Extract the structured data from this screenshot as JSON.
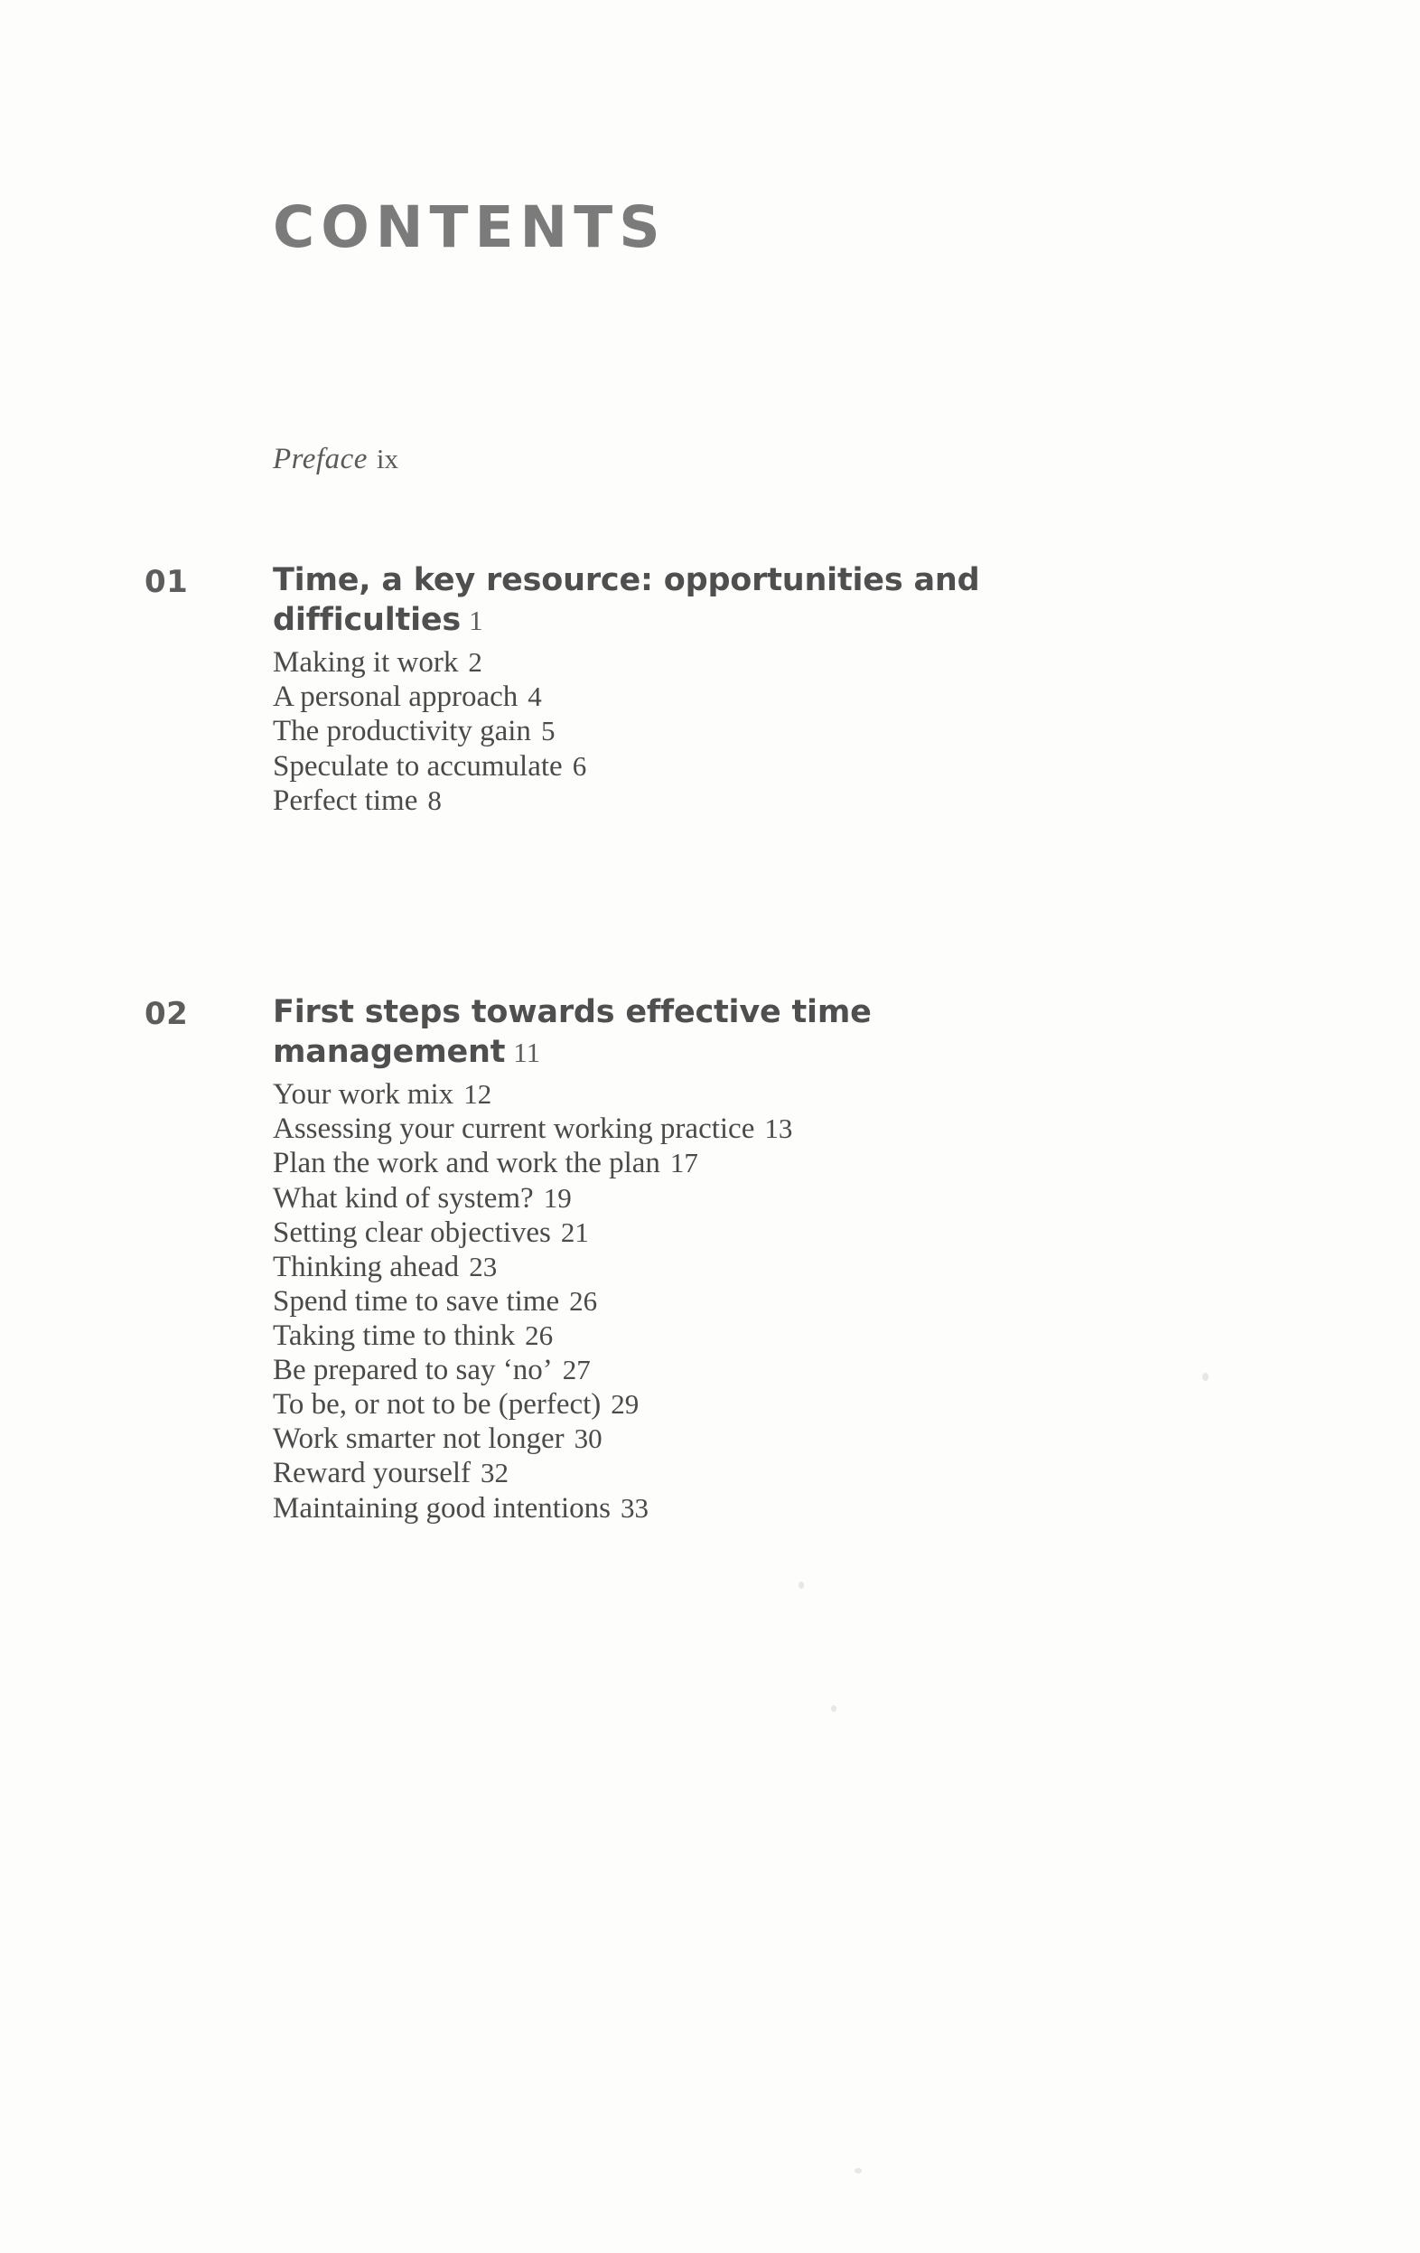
{
  "page": {
    "title": "CONTENTS",
    "background_color": "#fdfdfc",
    "title_color": "#7b7b7b",
    "text_color": "#4a4a4a"
  },
  "front_matter": [
    {
      "label": "Preface",
      "page": "ix"
    }
  ],
  "chapters": [
    {
      "number": "01",
      "title": "Time, a key resource: opportunities and difficulties",
      "page": "1",
      "sections": [
        {
          "label": "Making it work",
          "page": "2"
        },
        {
          "label": "A personal approach",
          "page": "4"
        },
        {
          "label": "The productivity gain",
          "page": "5"
        },
        {
          "label": "Speculate to accumulate",
          "page": "6"
        },
        {
          "label": "Perfect time",
          "page": "8"
        }
      ]
    },
    {
      "number": "02",
      "title": "First steps towards effective time management",
      "page": "11",
      "sections": [
        {
          "label": "Your work mix",
          "page": "12"
        },
        {
          "label": "Assessing your current working practice",
          "page": "13"
        },
        {
          "label": "Plan the work and work the plan",
          "page": "17"
        },
        {
          "label": "What kind of system?",
          "page": "19"
        },
        {
          "label": "Setting clear objectives",
          "page": "21"
        },
        {
          "label": "Thinking ahead",
          "page": "23"
        },
        {
          "label": "Spend time to save time",
          "page": "26"
        },
        {
          "label": "Taking time to think",
          "page": "26"
        },
        {
          "label": "Be prepared to say ‘no’",
          "page": "27"
        },
        {
          "label": "To be, or not to be (perfect)",
          "page": "29"
        },
        {
          "label": "Work smarter not longer",
          "page": "30"
        },
        {
          "label": "Reward yourself",
          "page": "32"
        },
        {
          "label": "Maintaining good intentions",
          "page": "33"
        }
      ]
    }
  ]
}
